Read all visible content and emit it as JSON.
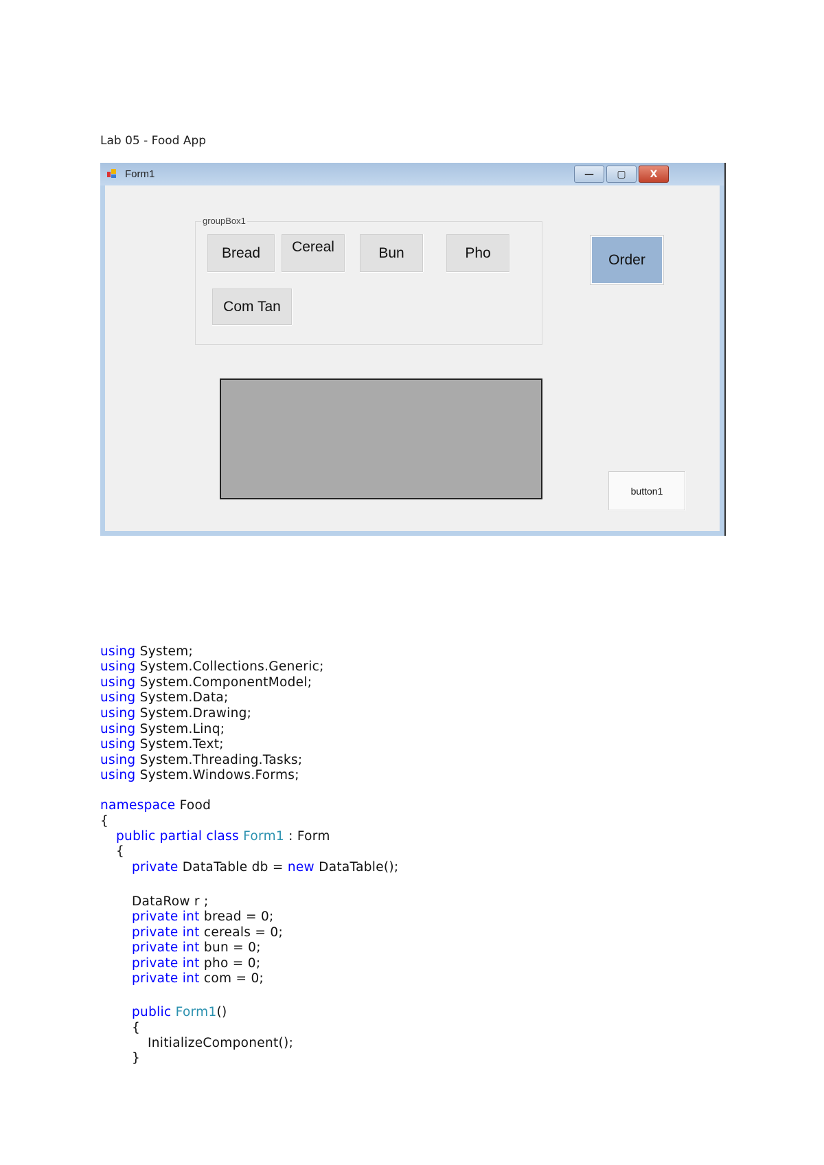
{
  "doc_title": "Lab 05 - Food App",
  "window": {
    "title": "Form1",
    "minimize": "—",
    "maximize": "▢",
    "close": "X",
    "groupbox_label": "groupBox1",
    "food_buttons": [
      "Bread",
      "Cereal",
      "Bun",
      "Pho",
      "Com Tan"
    ],
    "order_button": "Order",
    "button1": "button1",
    "colors": {
      "order": "#98b4d4",
      "panel": "#aaaaaa",
      "frame": "#b9d1ea"
    }
  },
  "code": [
    {
      "indent": 0,
      "tokens": [
        {
          "t": "using",
          "c": "kw"
        },
        {
          "t": " System;",
          "c": ""
        }
      ]
    },
    {
      "indent": 0,
      "tokens": [
        {
          "t": "using",
          "c": "kw"
        },
        {
          "t": " System.Collections.Generic;",
          "c": ""
        }
      ]
    },
    {
      "indent": 0,
      "tokens": [
        {
          "t": "using",
          "c": "kw"
        },
        {
          "t": " System.ComponentModel;",
          "c": ""
        }
      ]
    },
    {
      "indent": 0,
      "tokens": [
        {
          "t": "using",
          "c": "kw"
        },
        {
          "t": " System.Data;",
          "c": ""
        }
      ]
    },
    {
      "indent": 0,
      "tokens": [
        {
          "t": "using",
          "c": "kw"
        },
        {
          "t": " System.Drawing;",
          "c": ""
        }
      ]
    },
    {
      "indent": 0,
      "tokens": [
        {
          "t": "using",
          "c": "kw"
        },
        {
          "t": " System.Linq;",
          "c": ""
        }
      ]
    },
    {
      "indent": 0,
      "tokens": [
        {
          "t": "using",
          "c": "kw"
        },
        {
          "t": " System.Text;",
          "c": ""
        }
      ]
    },
    {
      "indent": 0,
      "tokens": [
        {
          "t": "using",
          "c": "kw"
        },
        {
          "t": " System.Threading.Tasks;",
          "c": ""
        }
      ]
    },
    {
      "indent": 0,
      "tokens": [
        {
          "t": "using",
          "c": "kw"
        },
        {
          "t": " System.Windows.Forms;",
          "c": ""
        }
      ]
    },
    {
      "indent": 0,
      "tokens": [
        {
          "t": "namespace",
          "c": "kw"
        },
        {
          "t": " Food",
          "c": ""
        }
      ]
    },
    {
      "indent": 0,
      "tokens": [
        {
          "t": "{",
          "c": ""
        }
      ]
    },
    {
      "indent": 1,
      "tokens": [
        {
          "t": "public partial class",
          "c": "kw"
        },
        {
          "t": " ",
          "c": ""
        },
        {
          "t": "Form1",
          "c": "ty"
        },
        {
          "t": " : Form",
          "c": ""
        }
      ]
    },
    {
      "indent": 1,
      "tokens": [
        {
          "t": "{",
          "c": ""
        }
      ]
    },
    {
      "indent": 2,
      "tokens": [
        {
          "t": "private",
          "c": "kw"
        },
        {
          "t": " DataTable db = ",
          "c": ""
        },
        {
          "t": "new",
          "c": "kw"
        },
        {
          "t": " DataTable();",
          "c": ""
        }
      ]
    },
    {
      "indent": 2,
      "tokens": [
        {
          "t": "DataRow r ;",
          "c": ""
        }
      ]
    },
    {
      "indent": 2,
      "tokens": [
        {
          "t": "private int",
          "c": "kw"
        },
        {
          "t": " bread = 0;",
          "c": ""
        }
      ]
    },
    {
      "indent": 2,
      "tokens": [
        {
          "t": "private int",
          "c": "kw"
        },
        {
          "t": " cereals = 0;",
          "c": ""
        }
      ]
    },
    {
      "indent": 2,
      "tokens": [
        {
          "t": "private int",
          "c": "kw"
        },
        {
          "t": " bun = 0;",
          "c": ""
        }
      ]
    },
    {
      "indent": 2,
      "tokens": [
        {
          "t": "private int",
          "c": "kw"
        },
        {
          "t": " pho = 0;",
          "c": ""
        }
      ]
    },
    {
      "indent": 2,
      "tokens": [
        {
          "t": "private int",
          "c": "kw"
        },
        {
          "t": " com = 0;",
          "c": ""
        }
      ]
    },
    {
      "indent": 2,
      "tokens": [
        {
          "t": "public",
          "c": "kw"
        },
        {
          "t": " ",
          "c": ""
        },
        {
          "t": "Form1",
          "c": "ty"
        },
        {
          "t": "()",
          "c": ""
        }
      ]
    },
    {
      "indent": 2,
      "tokens": [
        {
          "t": "{",
          "c": ""
        }
      ]
    },
    {
      "indent": 3,
      "tokens": [
        {
          "t": "InitializeComponent();",
          "c": ""
        }
      ]
    },
    {
      "indent": 2,
      "tokens": [
        {
          "t": "}",
          "c": ""
        }
      ]
    }
  ]
}
